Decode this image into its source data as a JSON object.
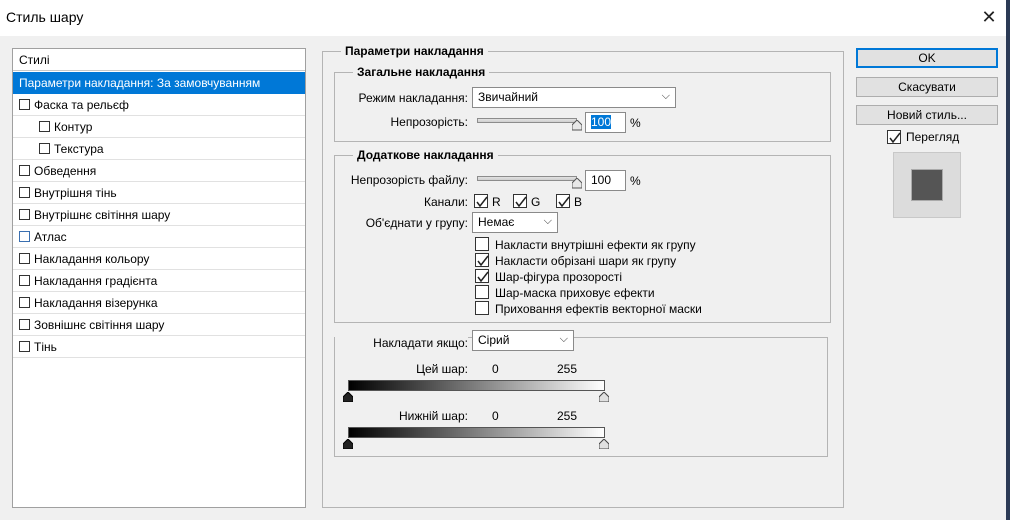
{
  "window": {
    "title": "Стиль шару",
    "close_icon": "close-icon"
  },
  "styles_panel": {
    "header": "Стилі",
    "items": [
      {
        "label": "Параметри накладання: За замовчуванням",
        "checkbox": false,
        "selected": true
      },
      {
        "label": "Фаска та рельєф",
        "checkbox": true
      },
      {
        "label": "Контур",
        "checkbox": true,
        "indent": true
      },
      {
        "label": "Текстура",
        "checkbox": true,
        "indent": true
      },
      {
        "label": "Обведення",
        "checkbox": true
      },
      {
        "label": "Внутрішня тінь",
        "checkbox": true
      },
      {
        "label": "Внутрішнє світіння шару",
        "checkbox": true
      },
      {
        "label": "Атлас",
        "checkbox": true
      },
      {
        "label": "Накладання кольору",
        "checkbox": true
      },
      {
        "label": "Накладання градієнта",
        "checkbox": true
      },
      {
        "label": "Накладання візерунка",
        "checkbox": true
      },
      {
        "label": "Зовнішнє світіння шару",
        "checkbox": true
      },
      {
        "label": "Тінь",
        "checkbox": true
      }
    ]
  },
  "blending": {
    "section_title": "Параметри накладання",
    "general": {
      "title": "Загальне накладання",
      "mode_label": "Режим накладання:",
      "mode_value": "Звичайний",
      "opacity_label": "Непрозорість:",
      "opacity_value": "100",
      "opacity_level": 1.0,
      "percent": "%"
    },
    "advanced": {
      "title": "Додаткове накладання",
      "fill_opacity_label": "Непрозорість файлу:",
      "fill_opacity_value": "100",
      "fill_opacity_level": 1.0,
      "percent": "%",
      "channels_label": "Канали:",
      "channels": [
        {
          "label": "R",
          "checked": true
        },
        {
          "label": "G",
          "checked": true
        },
        {
          "label": "B",
          "checked": true
        }
      ],
      "knockout_label": "Об'єднати у групу:",
      "knockout_value": "Немає",
      "options": [
        {
          "label": "Накласти внутрішні ефекти як групу",
          "checked": false
        },
        {
          "label": "Накласти обрізані шари як групу",
          "checked": true
        },
        {
          "label": "Шар-фігура прозорості",
          "checked": true
        },
        {
          "label": "Шар-маска приховує ефекти",
          "checked": false
        },
        {
          "label": "Приховання ефектів векторної маски",
          "checked": false
        }
      ]
    },
    "blend_if": {
      "label": "Накладати якщо:",
      "value": "Сірий",
      "this_layer_label": "Цей шар:",
      "this_layer_min": "0",
      "this_layer_max": "255",
      "underlying_label": "Нижній шар:",
      "underlying_min": "0",
      "underlying_max": "255"
    }
  },
  "buttons": {
    "ok": "OK",
    "cancel": "Скасувати",
    "new_style": "Новий стиль...",
    "preview_label": "Перегляд",
    "preview_checked": true
  },
  "colors": {
    "selection": "#0078d7",
    "preview_swatch": "#555555"
  }
}
